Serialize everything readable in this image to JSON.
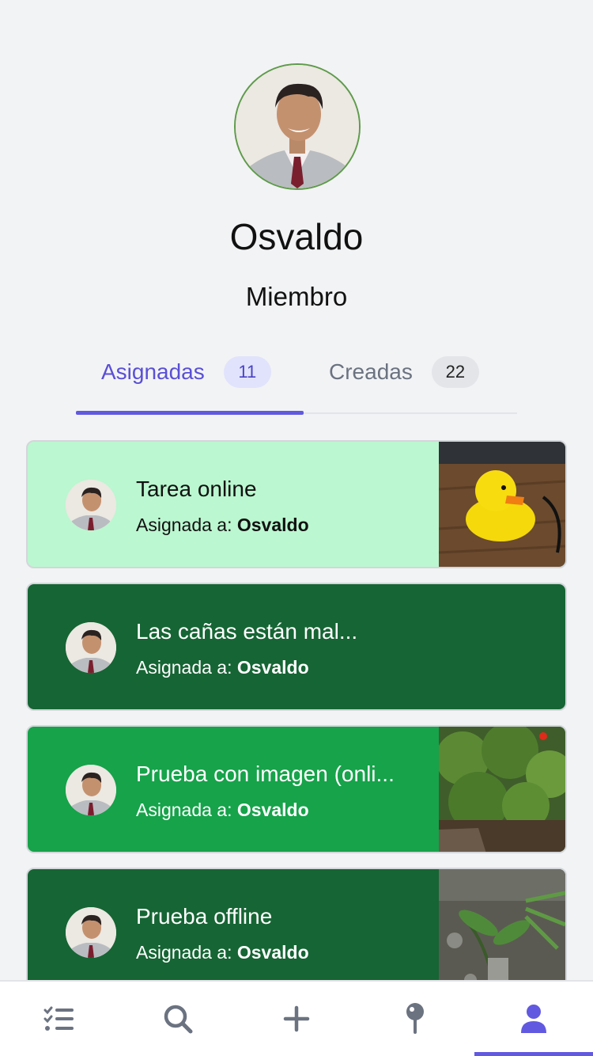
{
  "profile": {
    "name": "Osvaldo",
    "role": "Miembro"
  },
  "tabs": [
    {
      "label": "Asignadas",
      "count": "11",
      "active": true
    },
    {
      "label": "Creadas",
      "count": "22",
      "active": false
    }
  ],
  "tasks": [
    {
      "title": "Tarea online",
      "assigned_prefix": "Asignada a:",
      "assignee": "Osvaldo",
      "color": "#bbf7d0",
      "has_image": true,
      "image": "rubber-duck-photo"
    },
    {
      "title": "Las cañas están mal...",
      "assigned_prefix": "Asignada a:",
      "assignee": "Osvaldo",
      "color": "#166534",
      "has_image": false
    },
    {
      "title": "Prueba con imagen (onli...",
      "assigned_prefix": "Asignada a:",
      "assignee": "Osvaldo",
      "color": "#16a34a",
      "has_image": true,
      "image": "bushes-photo"
    },
    {
      "title": "Prueba offline",
      "assigned_prefix": "Asignada a:",
      "assignee": "Osvaldo",
      "color": "#166534",
      "has_image": true,
      "image": "plants-photo"
    }
  ],
  "navbar": {
    "items": [
      "tasks-list-icon",
      "search-icon",
      "add-icon",
      "map-pin-icon",
      "profile-icon"
    ],
    "active": "profile-icon",
    "accent": "#6159e0",
    "inactive_color": "#6b7280"
  }
}
